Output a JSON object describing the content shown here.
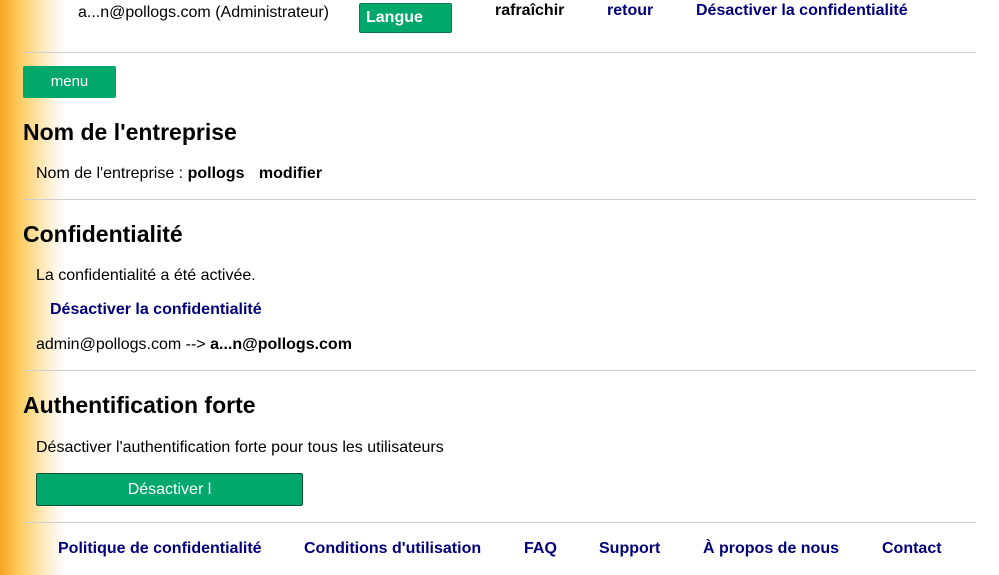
{
  "header": {
    "user_label": "a...n@pollogs.com (Administrateur)",
    "language_button": "Langue",
    "refresh_link": "rafraîchir",
    "back_link": "retour",
    "disable_privacy_link": "Désactiver la confidentialité"
  },
  "menu": {
    "label": "menu"
  },
  "company_section": {
    "title": "Nom de l'entreprise",
    "name_label": "Nom de l'entreprise :",
    "name_value": "pollogs",
    "modify_link": "modifier"
  },
  "privacy_section": {
    "title": "Confidentialité",
    "status_text": "La confidentialité a été activée.",
    "disable_link": "Désactiver la confidentialité",
    "mapping_from": "admin@pollogs.com -->",
    "mapping_to": "a...n@pollogs.com"
  },
  "auth_section": {
    "title": "Authentification forte",
    "description": "Désactiver l'authentification forte pour tous les utilisateurs",
    "disable_button": "Désactiver l"
  },
  "footer": {
    "links": [
      "Politique de confidentialité",
      "Conditions d'utilisation",
      "FAQ",
      "Support",
      "À propos de nous",
      "Contact"
    ]
  },
  "colors": {
    "accent_green": "#00a86b",
    "link_navy": "#00007a",
    "left_stripe_orange": "#f5a623"
  }
}
